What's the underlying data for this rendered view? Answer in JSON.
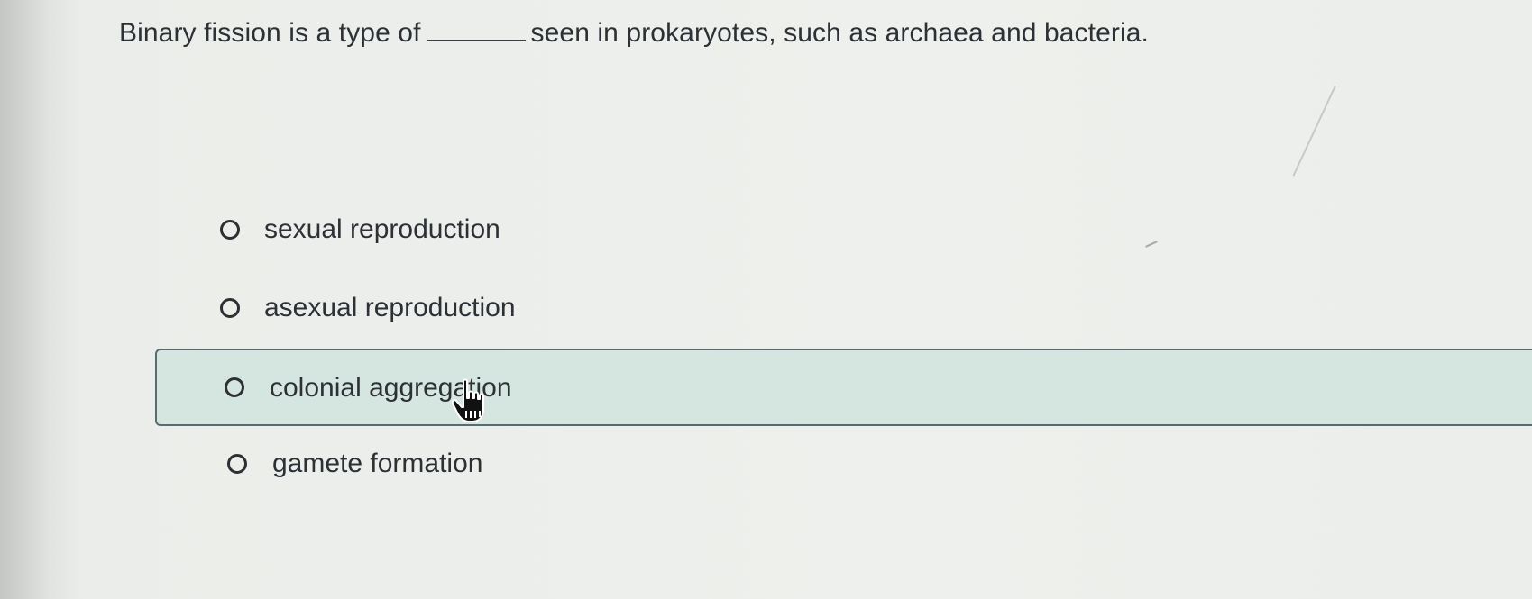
{
  "question": {
    "before_blank": "Binary fission is a type of",
    "after_blank": "seen in prokaryotes, such as archaea and bacteria."
  },
  "options": [
    {
      "label": "sexual reproduction",
      "selected": false,
      "hovered": false
    },
    {
      "label": "asexual reproduction",
      "selected": false,
      "hovered": false
    },
    {
      "label": "colonial aggregation",
      "selected": false,
      "hovered": true
    },
    {
      "label": "gamete formation",
      "selected": false,
      "hovered": false
    }
  ],
  "colors": {
    "hover_background": "#d4e6df",
    "hover_border": "#5a6b70",
    "text": "#2d3136"
  },
  "icons": {
    "radio": "radio-empty-icon",
    "cursor": "hand-pointer-cursor-icon"
  }
}
